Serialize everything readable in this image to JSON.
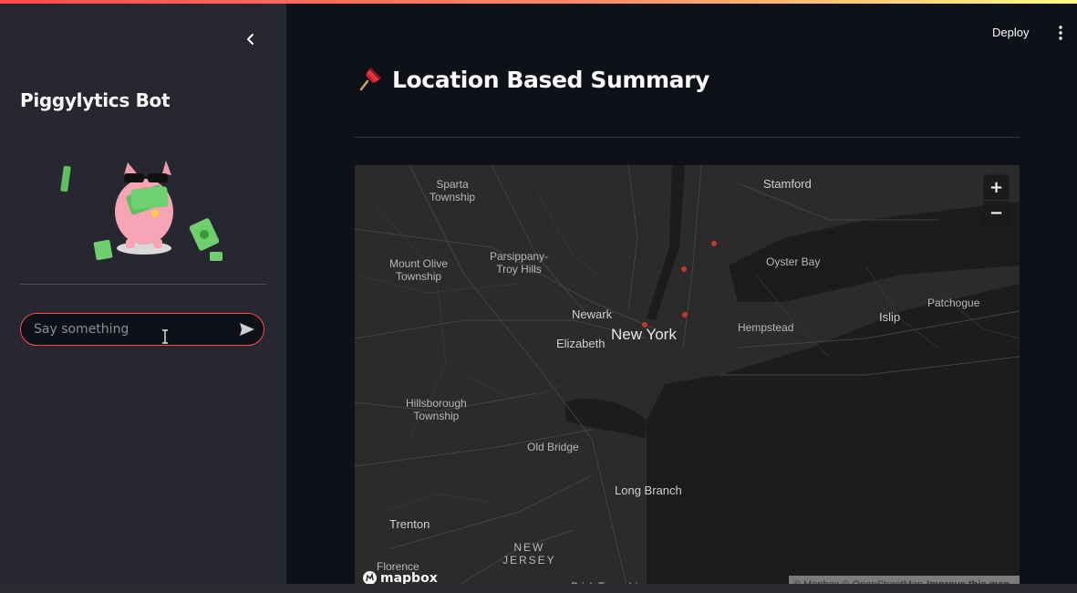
{
  "app": {
    "deploy_label": "Deploy"
  },
  "sidebar": {
    "title": "Piggylytics Bot",
    "chat_placeholder": "Say something"
  },
  "main": {
    "title": "Location Based Summary"
  },
  "map": {
    "labels": {
      "sparta": "Sparta\nTownship",
      "stamford": "Stamford",
      "parsippany": "Parsippany-\nTroy Hills",
      "mount_olive": "Mount Olive\nTownship",
      "oyster_bay": "Oyster Bay",
      "patchogue": "Patchogue",
      "newark": "Newark",
      "new_york": "New York",
      "elizabeth": "Elizabeth",
      "hempstead": "Hempstead",
      "islip": "Islip",
      "hillsborough": "Hillsborough\nTownship",
      "old_bridge": "Old Bridge",
      "long_branch": "Long Branch",
      "trenton": "Trenton",
      "new_jersey": "NEW\nJERSEY",
      "florence": "Florence",
      "brick": "Brick Township"
    },
    "zoom_in": "+",
    "zoom_out": "−",
    "logo_text": "mapbox",
    "attribution_text": "© Mapbox © OpenStreetMap",
    "improve_text": "Improve this map"
  }
}
